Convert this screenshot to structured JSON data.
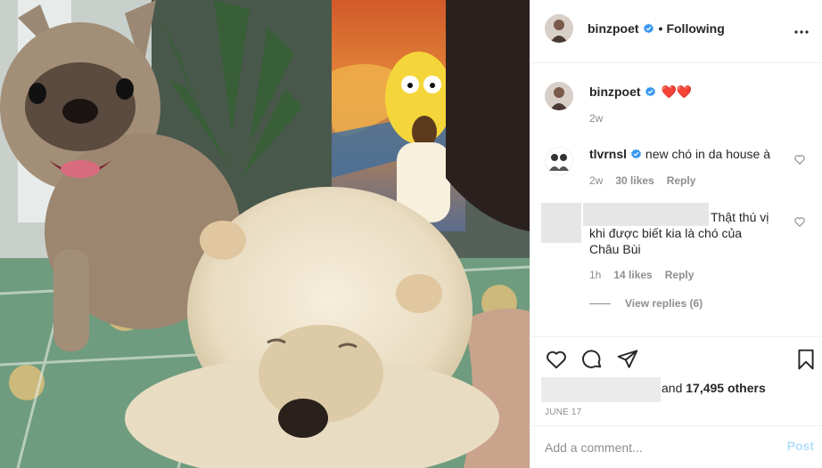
{
  "post": {
    "image_alt": "A French bulldog and a fluffy cream puppy on a tiled floor in front of a painted wall"
  },
  "header": {
    "username": "binzpoet",
    "separator": "•",
    "follow_status": "Following",
    "more_icon": "more-horizontal-icon"
  },
  "caption": {
    "username": "binzpoet",
    "text": "❤️❤️",
    "time": "2w"
  },
  "comments": [
    {
      "username": "tlvrnsl",
      "text": "new chó in da house à",
      "time": "2w",
      "likes": "30 likes",
      "reply": "Reply"
    },
    {
      "username": "",
      "text_line1": "Thật thú vị",
      "text_line2": "khi được biết kia là chó của",
      "text_line3": "Châu Bùi",
      "time": "1h",
      "likes": "14 likes",
      "reply": "Reply",
      "view_replies": "View replies (6)"
    }
  ],
  "actions": {
    "likes_prefix": "and ",
    "likes_count": "17,495 others",
    "date": "JUNE 17"
  },
  "add_comment": {
    "placeholder": "Add a comment...",
    "post_label": "Post"
  },
  "colors": {
    "verified": "#3897f0",
    "heart": "#ed4956",
    "post_disabled": "#b2dffc",
    "muted": "#8e8e8e"
  }
}
